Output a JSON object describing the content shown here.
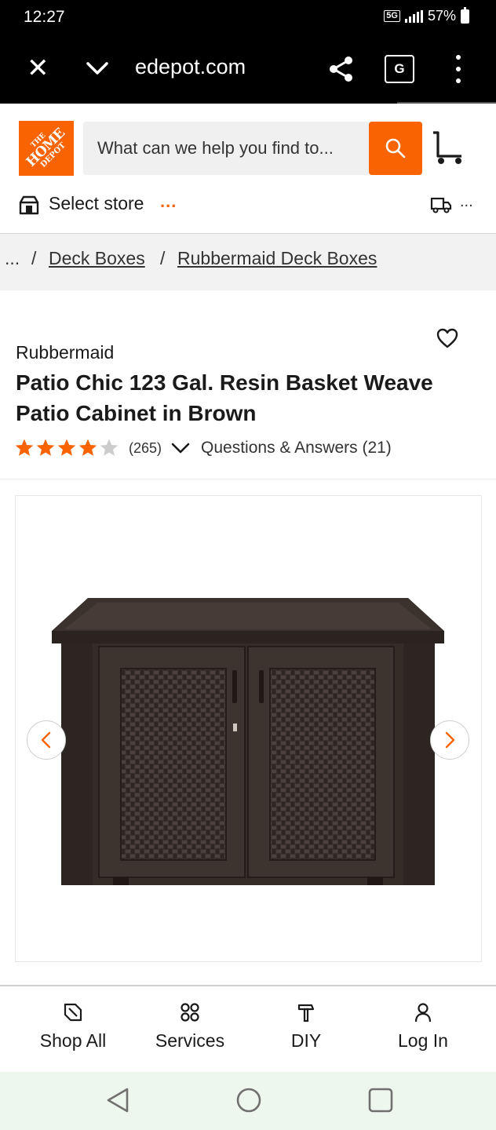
{
  "status_bar": {
    "time": "12:27",
    "network": "5G",
    "battery": "57%"
  },
  "browser": {
    "url": "edepot.com",
    "translate_glyph": "G",
    "icons": [
      "close-icon",
      "chevron-down-icon",
      "share-icon",
      "translate-icon",
      "more-vert-icon"
    ]
  },
  "header": {
    "logo_text": [
      "THE",
      "HOME",
      "DEPOT"
    ],
    "search_placeholder": "What can we help you find to...",
    "store_label": "Select store",
    "store_dots": "...",
    "delivery_dots": "..."
  },
  "breadcrumb": {
    "ellipsis": "...",
    "separator": "/",
    "items": [
      "Deck Boxes",
      "Rubbermaid Deck Boxes"
    ]
  },
  "product": {
    "brand": "Rubbermaid",
    "title": "Patio Chic 123 Gal. Resin Basket Weave Patio Cabinet in Brown",
    "rating": 4.0,
    "rating_max": 5,
    "review_count": "(265)",
    "qa_label": "Questions & Answers (21)"
  },
  "bottom_nav": {
    "items": [
      {
        "label": "Shop All",
        "icon": "tag-icon"
      },
      {
        "label": "Services",
        "icon": "grid-icon"
      },
      {
        "label": "DIY",
        "icon": "hammer-icon"
      },
      {
        "label": "Log In",
        "icon": "person-icon"
      }
    ]
  },
  "colors": {
    "brand_orange": "#f96302",
    "star_filled": "#f96302",
    "star_empty": "#cccccc"
  }
}
